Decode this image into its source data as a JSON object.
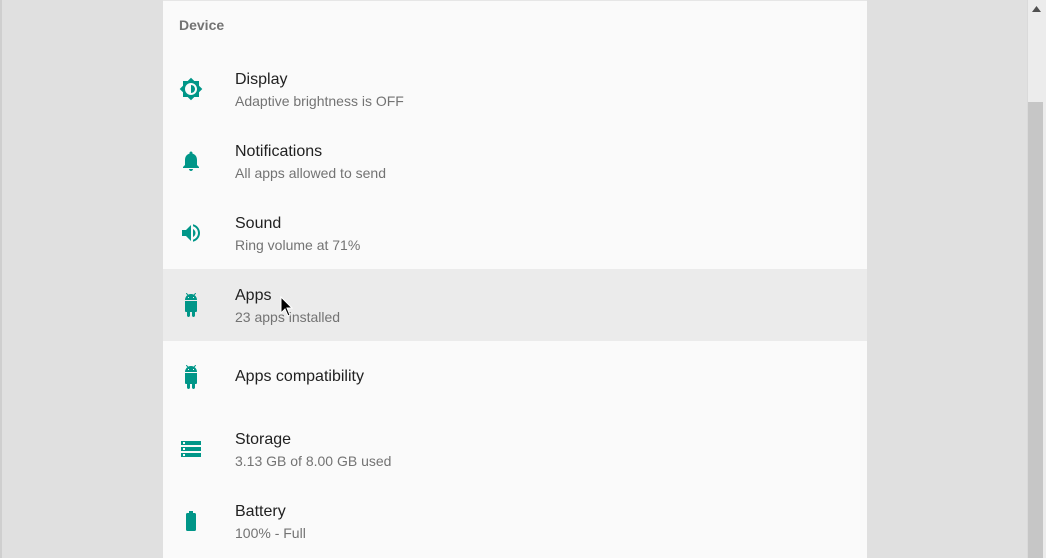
{
  "section": {
    "header": "Device"
  },
  "items": [
    {
      "title": "Display",
      "summary": "Adaptive brightness is OFF",
      "icon": "brightness-icon"
    },
    {
      "title": "Notifications",
      "summary": "All apps allowed to send",
      "icon": "bell-icon"
    },
    {
      "title": "Sound",
      "summary": "Ring volume at 71%",
      "icon": "volume-icon"
    },
    {
      "title": "Apps",
      "summary": "23 apps installed",
      "icon": "android-icon"
    },
    {
      "title": "Apps compatibility",
      "summary": "",
      "icon": "android-icon"
    },
    {
      "title": "Storage",
      "summary": "3.13 GB of 8.00 GB used",
      "icon": "storage-icon"
    },
    {
      "title": "Battery",
      "summary": "100% - Full",
      "icon": "battery-icon"
    }
  ],
  "colors": {
    "accent": "#009688",
    "background": "#fafafa",
    "hover": "#ebebeb",
    "outer": "#e0e0e0"
  }
}
